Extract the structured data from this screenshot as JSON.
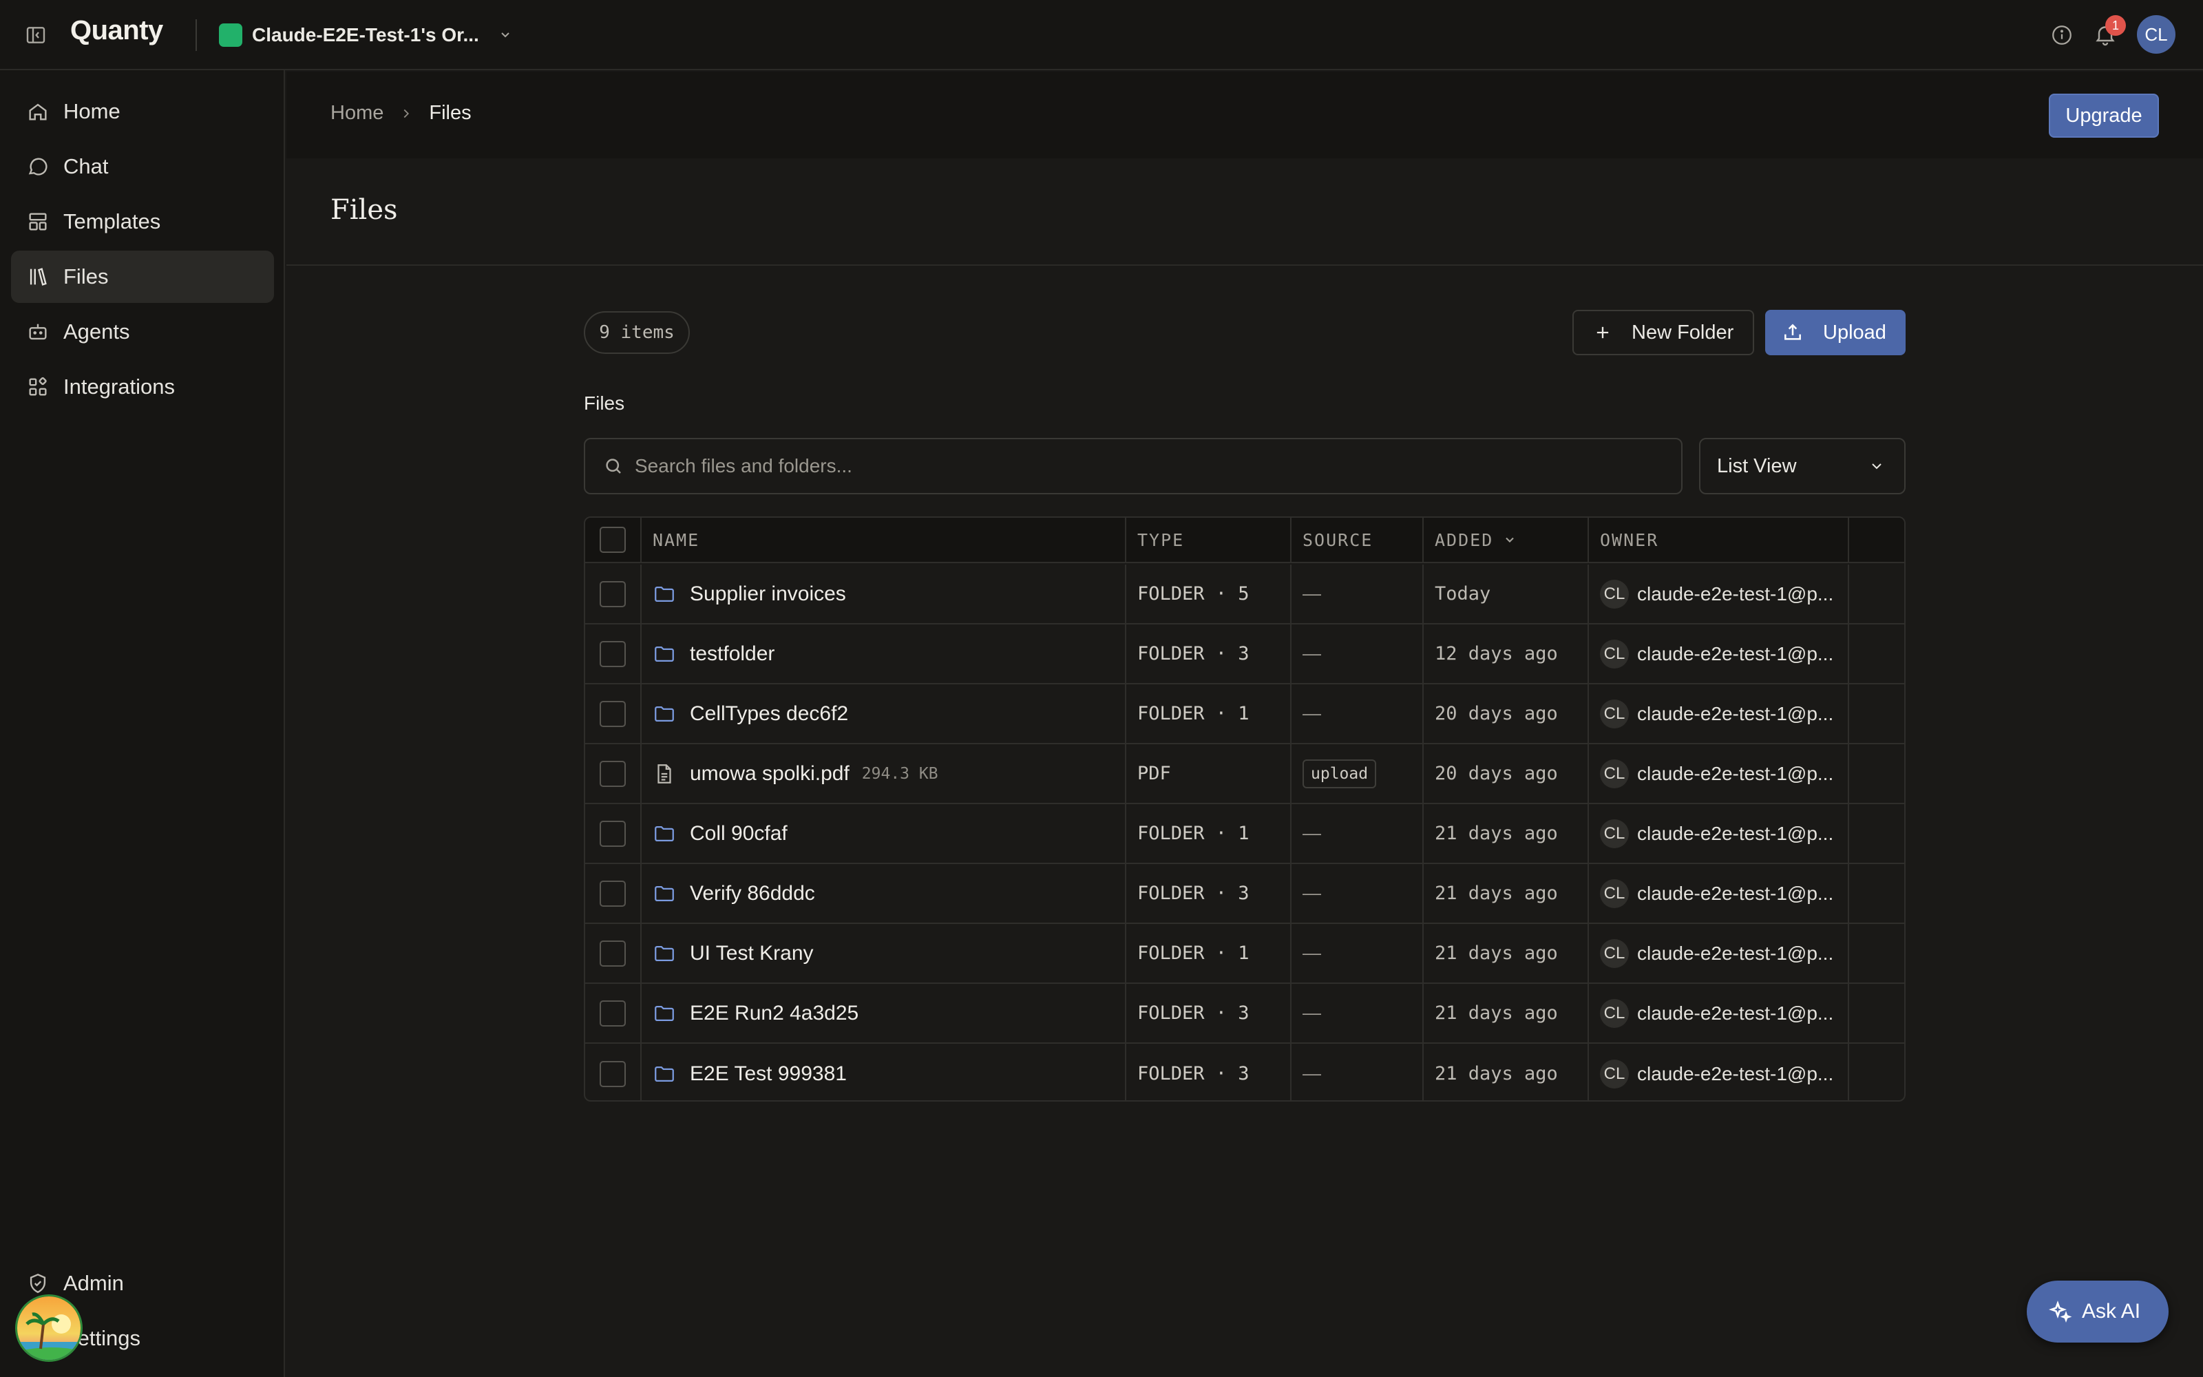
{
  "app": {
    "logo": "Quanty"
  },
  "topbar": {
    "org_name": "Claude-E2E-Test-1's Or...",
    "notification_count": "1",
    "avatar_initials": "CL"
  },
  "sidebar": {
    "items": [
      {
        "label": "Home",
        "icon": "home-icon"
      },
      {
        "label": "Chat",
        "icon": "chat-icon"
      },
      {
        "label": "Templates",
        "icon": "templates-icon"
      },
      {
        "label": "Files",
        "icon": "files-icon",
        "active": true
      },
      {
        "label": "Agents",
        "icon": "agents-icon"
      },
      {
        "label": "Integrations",
        "icon": "integrations-icon"
      }
    ],
    "bottom_items": [
      {
        "label": "Admin",
        "icon": "shield-icon"
      },
      {
        "label": "Settings",
        "icon": "settings-icon"
      }
    ]
  },
  "breadcrumb": {
    "home": "Home",
    "current": "Files"
  },
  "upgrade_label": "Upgrade",
  "page_title": "Files",
  "toolbar": {
    "items_count": "9 items",
    "new_folder_label": "New Folder",
    "upload_label": "Upload"
  },
  "section_label": "Files",
  "search": {
    "placeholder": "Search files and folders..."
  },
  "view_select": {
    "value": "List View"
  },
  "table": {
    "columns": {
      "name": "NAME",
      "type": "TYPE",
      "source": "SOURCE",
      "added": "ADDED",
      "owner": "OWNER"
    },
    "rows": [
      {
        "name": "Supplier invoices",
        "kind": "folder",
        "size": "",
        "type": "FOLDER · 5",
        "source": "—",
        "added": "Today",
        "owner_initials": "CL",
        "owner": "claude-e2e-test-1@p..."
      },
      {
        "name": "testfolder",
        "kind": "folder",
        "size": "",
        "type": "FOLDER · 3",
        "source": "—",
        "added": "12 days ago",
        "owner_initials": "CL",
        "owner": "claude-e2e-test-1@p..."
      },
      {
        "name": "CellTypes dec6f2",
        "kind": "folder",
        "size": "",
        "type": "FOLDER · 1",
        "source": "—",
        "added": "20 days ago",
        "owner_initials": "CL",
        "owner": "claude-e2e-test-1@p..."
      },
      {
        "name": "umowa spolki.pdf",
        "kind": "file",
        "size": "294.3 KB",
        "type": "PDF",
        "source": "upload",
        "added": "20 days ago",
        "owner_initials": "CL",
        "owner": "claude-e2e-test-1@p..."
      },
      {
        "name": "Coll 90cfaf",
        "kind": "folder",
        "size": "",
        "type": "FOLDER · 1",
        "source": "—",
        "added": "21 days ago",
        "owner_initials": "CL",
        "owner": "claude-e2e-test-1@p..."
      },
      {
        "name": "Verify 86dddc",
        "kind": "folder",
        "size": "",
        "type": "FOLDER · 3",
        "source": "—",
        "added": "21 days ago",
        "owner_initials": "CL",
        "owner": "claude-e2e-test-1@p..."
      },
      {
        "name": "UI Test Krany",
        "kind": "folder",
        "size": "",
        "type": "FOLDER · 1",
        "source": "—",
        "added": "21 days ago",
        "owner_initials": "CL",
        "owner": "claude-e2e-test-1@p..."
      },
      {
        "name": "E2E Run2 4a3d25",
        "kind": "folder",
        "size": "",
        "type": "FOLDER · 3",
        "source": "—",
        "added": "21 days ago",
        "owner_initials": "CL",
        "owner": "claude-e2e-test-1@p..."
      },
      {
        "name": "E2E Test 999381",
        "kind": "folder",
        "size": "",
        "type": "FOLDER · 3",
        "source": "—",
        "added": "21 days ago",
        "owner_initials": "CL",
        "owner": "claude-e2e-test-1@p..."
      }
    ]
  },
  "ask_ai_label": "Ask AI",
  "colors": {
    "accent": "#4c67a8",
    "org": "#22b16a",
    "badge": "#e0544b",
    "folder_icon": "#7b9be0"
  }
}
